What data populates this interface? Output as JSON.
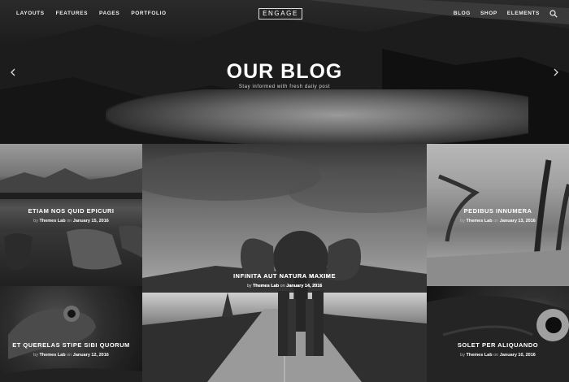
{
  "nav": {
    "left": [
      "LAYOUTS",
      "FEATURES",
      "PAGES",
      "PORTFOLIO"
    ],
    "right": [
      "BLOG",
      "SHOP",
      "ELEMENTS"
    ],
    "logo": "ENGAGE"
  },
  "hero": {
    "title": "OUR BLOG",
    "subtitle": "Stay informed with fresh daily post"
  },
  "posts": [
    {
      "title": "ETIAM NOS QUID EPICURI",
      "by": "by",
      "author": "Themes Lab",
      "on": "on",
      "date": "January 15, 2016"
    },
    {
      "title": "INFINITA AUT NATURA MAXIME",
      "by": "by",
      "author": "Themes Lab",
      "on": "on",
      "date": "January 14, 2016"
    },
    {
      "title": "PEDIBUS INNUMERA",
      "by": "by",
      "author": "Themes Lab",
      "on": "on",
      "date": "January 13, 2016"
    },
    {
      "title": "ET QUERELAS STIPE SIBI QUORUM",
      "by": "by",
      "author": "Themes Lab",
      "on": "on",
      "date": "January 12, 2016"
    },
    {
      "title": "SOLET PER ALIQUANDO",
      "by": "by",
      "author": "Themes Lab",
      "on": "on",
      "date": "January 10, 2016"
    }
  ],
  "icons": {
    "search": "search-icon",
    "prev": "chevron-left-icon",
    "next": "chevron-right-icon"
  }
}
